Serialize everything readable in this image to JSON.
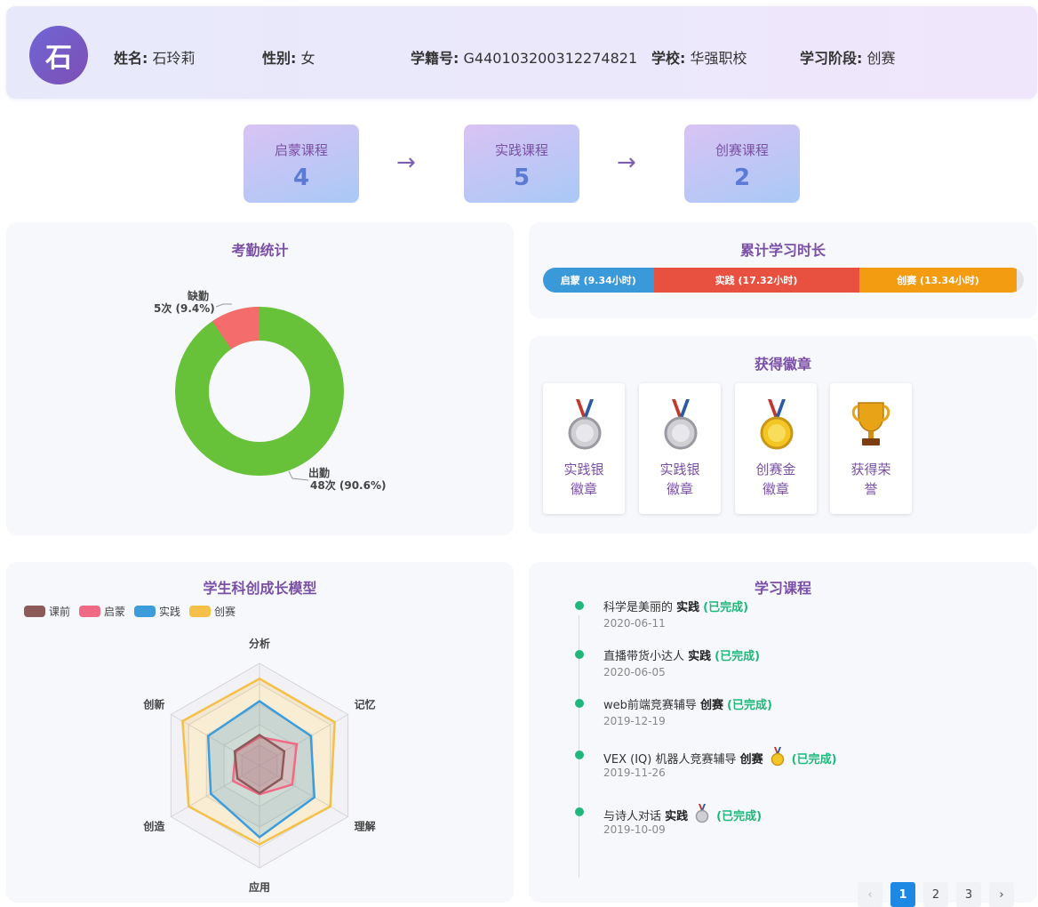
{
  "student": {
    "avatar_char": "石",
    "name_label": "姓名:",
    "name": "石玲莉",
    "gender_label": "性别:",
    "gender": "女",
    "id_label": "学籍号:",
    "id": "G440103200312274821",
    "school_label": "学校:",
    "school": "华强职校",
    "stage_label": "学习阶段:",
    "stage": "创赛"
  },
  "courses": [
    {
      "label": "启蒙课程",
      "count": "4"
    },
    {
      "label": "实践课程",
      "count": "5"
    },
    {
      "label": "创赛课程",
      "count": "2"
    }
  ],
  "arrow": "→",
  "attendance": {
    "title": "考勤统计",
    "absent_label": "缺勤",
    "absent_value": "5次 (9.4%)",
    "present_label": "出勤",
    "present_value": "48次 (90.6%)"
  },
  "study_time": {
    "title": "累计学习时长",
    "segments": [
      {
        "label": "启蒙 (9.34小时)",
        "hours": 9.34,
        "color": "#3a9ad9"
      },
      {
        "label": "实践 (17.32小时)",
        "hours": 17.32,
        "color": "#e8503f"
      },
      {
        "label": "创赛 (13.34小时)",
        "hours": 13.34,
        "color": "#f39c12"
      }
    ]
  },
  "badges": {
    "title": "获得徽章",
    "items": [
      {
        "name": "实践银徽章",
        "icon": "silver-medal-icon"
      },
      {
        "name": "实践银徽章",
        "icon": "silver-medal-icon"
      },
      {
        "name": "创赛金徽章",
        "icon": "gold-medal-icon"
      },
      {
        "name": "获得荣誉",
        "icon": "trophy-icon"
      }
    ]
  },
  "chart_data": {
    "type": "radar",
    "title": "学生科创成长模型",
    "indicators": [
      "分析",
      "记忆",
      "理解",
      "应用",
      "创造",
      "创新"
    ],
    "series": [
      {
        "name": "课前",
        "color": "#8d5a5a",
        "values": [
          0.3,
          0.28,
          0.25,
          0.27,
          0.25,
          0.28
        ]
      },
      {
        "name": "启蒙",
        "color": "#f06a86",
        "values": [
          0.28,
          0.42,
          0.37,
          0.28,
          0.3,
          0.27
        ]
      },
      {
        "name": "实践",
        "color": "#3d9ddb",
        "values": [
          0.63,
          0.58,
          0.62,
          0.7,
          0.55,
          0.58
        ]
      },
      {
        "name": "创赛",
        "color": "#f5c04a",
        "values": [
          0.85,
          0.85,
          0.8,
          0.77,
          0.8,
          0.87
        ]
      }
    ]
  },
  "learning": {
    "title": "学习课程",
    "done_label": "(已完成)",
    "items": [
      {
        "title": "科学是美丽的",
        "cat": "实践",
        "date": "2020-06-11",
        "medal": ""
      },
      {
        "title": "直播带货小达人",
        "cat": "实践",
        "date": "2020-06-05",
        "medal": ""
      },
      {
        "title": "web前端竞赛辅导",
        "cat": "创赛",
        "date": "2019-12-19",
        "medal": ""
      },
      {
        "title": "VEX (IQ) 机器人竞赛辅导",
        "cat": "创赛",
        "date": "2019-11-26",
        "medal": "gold"
      },
      {
        "title": "与诗人对话",
        "cat": "实践",
        "date": "2019-10-09",
        "medal": "silver"
      }
    ],
    "pages": [
      "1",
      "2",
      "3"
    ],
    "prev": "‹",
    "next": "›"
  }
}
